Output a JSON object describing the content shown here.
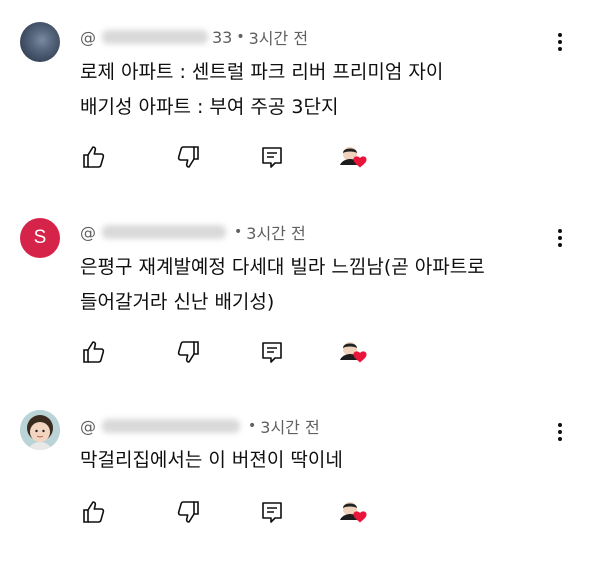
{
  "comments": [
    {
      "avatar_type": "photo-dark",
      "handle_prefix": "@",
      "handle_tail": "33",
      "time": "3시간 전",
      "dot": "•",
      "lines": [
        "로제 아파트 : 센트럴 파크 리버 프리미엄 자이",
        "배기성 아파트 : 부여 주공 3단지"
      ],
      "actions": [
        "like",
        "dislike",
        "reply",
        "creator-heart"
      ],
      "menu_icon": "more-vert-icon"
    },
    {
      "avatar_type": "letter",
      "avatar_letter": "S",
      "avatar_color": "#d6234a",
      "handle_prefix": "@",
      "handle_tail": "",
      "time": "3시간 전",
      "dot": "•",
      "lines": [
        "은평구 재계발예정 다세대 빌라 느낌남(곧 아파트로",
        "들어갈거라 신난 배기성)"
      ],
      "actions": [
        "like",
        "dislike",
        "reply",
        "creator-heart"
      ],
      "menu_icon": "more-vert-icon"
    },
    {
      "avatar_type": "photo-child",
      "handle_prefix": "@",
      "handle_tail": "",
      "time": "3시간 전",
      "dot": "•",
      "lines": [
        "막걸리집에서는 이 버젼이 딱이네"
      ],
      "actions": [
        "like",
        "dislike",
        "reply",
        "creator-heart"
      ],
      "menu_icon": "more-vert-icon"
    }
  ],
  "colors": {
    "text_primary": "#0f0f0f",
    "text_secondary": "#606060",
    "heart": "#e8143a"
  }
}
